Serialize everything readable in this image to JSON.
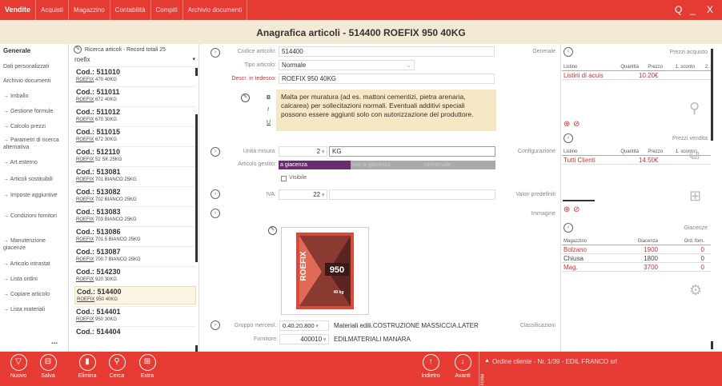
{
  "topbar": {
    "tabs": [
      "Vendite",
      "Acquisti",
      "Magazzino",
      "Contabilità",
      "Compiti",
      "Archivio documenti"
    ],
    "search_glyph": "Q",
    "minimize_glyph": "_",
    "close_glyph": "X"
  },
  "page_title": "Anagrafica articoli - 514400 ROEFIX 950 40KG",
  "leftnav": {
    "items": [
      "Generale",
      "Dati personalizzati",
      "Archivio documenti",
      "→ Imballo",
      "→ Gestione formule",
      "→ Calcolo prezzi",
      "→ Parametri di ricerca alternativa",
      "→ Art.esterno",
      "→ Articoli sostituibili",
      "→ Imposte aggiuntive",
      "→ Condizioni fornitori",
      "→ Manutenzione giacenze",
      "→ Articolo intrastat",
      "→ Lista ordini",
      "→ Copiare articolo",
      "→ Lista materiali"
    ],
    "more": "..."
  },
  "records": {
    "header": "Ricerca articoli - Record totali 25",
    "filter": "roefix",
    "items": [
      {
        "code": "Cod.: 511010",
        "brand": "ROEFIX",
        "desc": " 470 40KG"
      },
      {
        "code": "Cod.: 511011",
        "brand": "ROEFIX",
        "desc": " 672 40KG"
      },
      {
        "code": "Cod.: 511012",
        "brand": "ROEFIX",
        "desc": " 670 30KG"
      },
      {
        "code": "Cod.: 511015",
        "brand": "ROEFIX",
        "desc": " 672 30KG"
      },
      {
        "code": "Cod.: 512110",
        "brand": "ROEFIX",
        "desc": " 52 SK 25KG"
      },
      {
        "code": "Cod.: 513081",
        "brand": "ROEFIX",
        "desc": " 701 BIANCO 25KG"
      },
      {
        "code": "Cod.: 513082",
        "brand": "ROEFIX",
        "desc": " 702 BIANCO 25KG"
      },
      {
        "code": "Cod.: 513083",
        "brand": "ROEFIX",
        "desc": " 703 BIANCO 25KG"
      },
      {
        "code": "Cod.: 513086",
        "brand": "ROEFIX",
        "desc": " 701.5 BIANCO 25KG"
      },
      {
        "code": "Cod.: 513087",
        "brand": "ROEFIX",
        "desc": " 700.7 BIANCO 25KG"
      },
      {
        "code": "Cod.: 514230",
        "brand": "ROEFIX",
        "desc": " 920 30KG"
      },
      {
        "code": "Cod.: 514400",
        "brand": "ROEFIX",
        "desc": " 950 40KG"
      },
      {
        "code": "Cod.: 514401",
        "brand": "ROEFIX",
        "desc": " 950 30KG"
      },
      {
        "code": "Cod.: 514404",
        "brand": "",
        "desc": ""
      }
    ]
  },
  "form": {
    "codice_label": "Codice articolo:",
    "codice_value": "514400",
    "tipo_label": "Tipo articolo:",
    "tipo_value": "Normale",
    "descr_label": "Descr. in tedesco:",
    "descr_value": "ROEFIX 950 40KG",
    "section_generale": "Generale",
    "note_text": "Malta per muratura (ad es. mattoni cementizi, pietra arenaria, calcarea) per sollecitazioni normali. Eventuali additivi speciali possono essere aggiunti solo con autorizzazione del produttore.",
    "fmt_bold": "B",
    "fmt_italic": "I",
    "fmt_underline": "U",
    "unita_label": "Unità misura:",
    "unita_num": "2",
    "unita_value": "KG",
    "section_config": "Configurazione",
    "gestito_label": "Articolo gestito:",
    "gestito_options": [
      "a giacenza",
      "non a giacenza",
      "Universale"
    ],
    "visibile_label": "Visibile",
    "iva_label": "IVA:",
    "iva_value": "22",
    "section_valori": "Valori predefiniti",
    "section_immagine": "Immagine",
    "image_brand": "ROEFIX",
    "image_code": "950",
    "image_weight": "40 kg",
    "gruppo_label": "Gruppo merceol.:",
    "gruppo_code": "0.40.20.800",
    "gruppo_value": "Materiali edili.COSTRUZIONE MASSICCIA.LATER",
    "fornitore_label": "Fornitore:",
    "fornitore_code": "400010",
    "fornitore_value": "EDILMATERIALI MANARA",
    "section_class": "Classificazioni"
  },
  "right": {
    "acquisto_title": "Prezzi acquisto",
    "acquisto_cols": [
      "Listino",
      "Quantità",
      "Prezzo",
      "1. sconto",
      "2."
    ],
    "acquisto_rows": [
      {
        "listino": "Listini di acuis",
        "prezzo": "10.20€"
      }
    ],
    "vendita_title": "Prezzi vendita",
    "vendita_cols": [
      "Listino",
      "Quantità",
      "Prezzo",
      "1. sconto"
    ],
    "vendita_rows": [
      {
        "listino": "Tutti Clienti",
        "prezzo": "14.50€"
      }
    ],
    "giacenze_title": "Giacenze",
    "giacenze_cols": [
      "Magazzino",
      "Giacenza",
      "Ord. forn."
    ],
    "giacenze_rows": [
      {
        "mag": "Bolzano",
        "giac": "1900",
        "ord": "0"
      },
      {
        "mag": "Chiusa",
        "giac": "1800",
        "ord": "0"
      },
      {
        "mag": "Mag.",
        "giac": "3700",
        "ord": "0"
      }
    ]
  },
  "bottom": {
    "buttons": [
      "Nuovo",
      "Salva",
      "Elimina",
      "Cerca",
      "Extra"
    ],
    "nav": [
      "Indietro",
      "Avanti"
    ],
    "form_tag": "FORM",
    "status": "Ordine cliente - Nr. 1/39 - EDIL FRANCO srl"
  },
  "colors": {
    "accent": "#e53b32",
    "title_bg": "#f3e9d4",
    "note_bg": "#f6e8c4",
    "selected": "#6b2c6e"
  }
}
